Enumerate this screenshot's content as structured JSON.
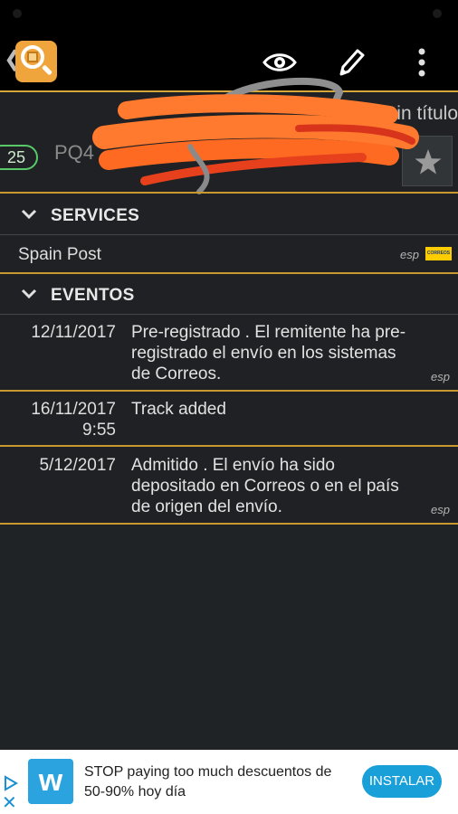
{
  "appbar": {
    "title": "Sin título",
    "tracking_count": "25",
    "tracking_code_partial": "PQ4"
  },
  "sections": {
    "services_label": "SERVICES",
    "events_label": "EVENTOS"
  },
  "services": [
    {
      "name": "Spain Post",
      "lang": "esp",
      "logo": "CORREOS"
    }
  ],
  "events": [
    {
      "date": "12/11/2017",
      "text": "Pre-registrado . El remitente ha pre-registrado el envío en los sistemas de Correos.",
      "lang": "esp"
    },
    {
      "date": "16/11/2017\n9:55",
      "text": "Track added",
      "lang": ""
    },
    {
      "date": "5/12/2017",
      "text": "Admitido . El envío ha sido depositado en Correos o en el país de origen del envío.",
      "lang": "esp"
    }
  ],
  "ad": {
    "text": "STOP paying too much descuentos de 50-90% hoy día",
    "button": "INSTALAR",
    "logo": "w"
  },
  "colors": {
    "accent_gold": "#d6a83a",
    "pill_green": "#58c868",
    "scribble_orange": "#ff7a2e",
    "ad_blue": "#1aa0d9"
  },
  "icons": [
    "back-icon",
    "app-logo-icon",
    "eye-icon",
    "pencil-icon",
    "more-icon",
    "star-icon",
    "chevron-down-icon",
    "ad-play-icon",
    "close-icon"
  ]
}
